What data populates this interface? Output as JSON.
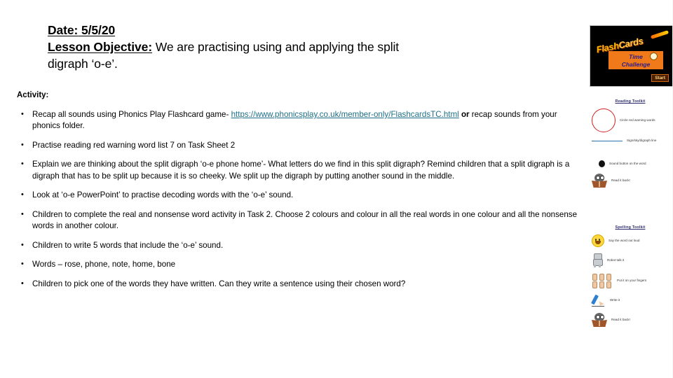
{
  "slide": {
    "title": {
      "date_label": "Date:",
      "date_value": " 5/5/20",
      "objective_label": "Lesson Objective:",
      "objective_text": " We are practising using and applying the split",
      "objective_text_line2": "digraph  ‘o-e’."
    },
    "activity_heading": "Activity:",
    "bullets": [
      {
        "id": "bullet-recap-sounds",
        "pre": "Recap all sounds using Phonics Play Flashcard game- ",
        "link": "https://www.phonicsplay.co.uk/member-only/FlashcardsTC.html",
        "bold": "or",
        "post": " recap sounds from your phonics folder."
      },
      {
        "id": "bullet-red-words",
        "text": "Practise reading red warning word list 7 on Task Sheet 2"
      },
      {
        "id": "bullet-explain-split-digraph",
        "text": "Explain we are thinking about the split digraph ‘o-e phone home’- What letters do we find in this split digraph? Remind children that a split digraph is a digraph that has to be split up because it is so cheeky. We split up the digraph by putting another sound in the middle."
      },
      {
        "id": "bullet-powerpoint",
        "text": "Look at ‘o-e PowerPoint’ to practise decoding words with the ‘o-e’ sound."
      },
      {
        "id": "bullet-real-nonsense",
        "text": "Children to complete the real and nonsense word activity in Task 2. Choose 2 colours and colour in all the real words in one colour and all the nonsense words in another colour."
      },
      {
        "id": "bullet-write-5-words",
        "text": "Children to write 5 words that include the ‘o-e’ sound."
      },
      {
        "id": "bullet-word-list",
        "text": "Words – rose, phone, note, home, bone"
      },
      {
        "id": "bullet-sentence",
        "text": "Children to pick one of the words they have written. Can they write a sentence using their chosen word?"
      }
    ],
    "flashcard_image": {
      "title_flash": "Flash",
      "title_cards": "Cards",
      "banner_line1": "Time",
      "banner_line2": "Challenge",
      "start_button": "Start"
    },
    "reading_toolkit": {
      "title": "Reading Toolkit",
      "items": [
        {
          "icon": "red-circle-icon",
          "label": "Circle red warning words"
        },
        {
          "icon": "underline-icon",
          "label": "Sign/sky/digraph line"
        }
      ]
    },
    "reading_toolkit_extra": {
      "items": [
        {
          "icon": "sound-button-dot-icon",
          "label": "Sound button on the word"
        },
        {
          "icon": "owl-reading-icon",
          "label": "Read it back!"
        }
      ]
    },
    "spelling_toolkit": {
      "title": "Spelling Toolkit",
      "items": [
        {
          "icon": "smiley-face-icon",
          "label": "Say the word out loud"
        },
        {
          "icon": "robot-icon",
          "label": "Robot talk it"
        },
        {
          "icon": "fingers-icon",
          "label": "Put it on your fingers"
        },
        {
          "icon": "pencil-icon",
          "label": "Write it"
        },
        {
          "icon": "owl-reading-icon",
          "label": "Read it back!"
        }
      ]
    },
    "colors": {
      "link": "#1f6f86",
      "red_circle": "#cf2222",
      "toolkit_title": "#2e2e6e",
      "flashcard_bg": "#000000",
      "flashcard_banner": "#f0791a"
    }
  }
}
